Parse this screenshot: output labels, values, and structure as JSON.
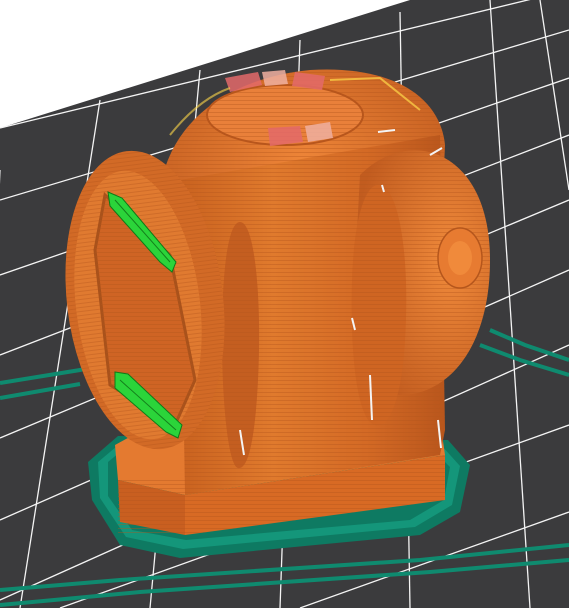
{
  "viewport": {
    "description_label": "",
    "colors": {
      "background": "#ffffff",
      "bed_surface": "#3b3b3d",
      "grid_line": "#f2f2f2",
      "perimeter_orange": "#d86a24",
      "perimeter_dark": "#a9521b",
      "perimeter_light": "#f08a3b",
      "support_green": "#2bd43a",
      "skirt_teal": "#0f8a6f",
      "travel_red": "#e06a6a",
      "infill_yellow": "#ffd84a"
    }
  }
}
